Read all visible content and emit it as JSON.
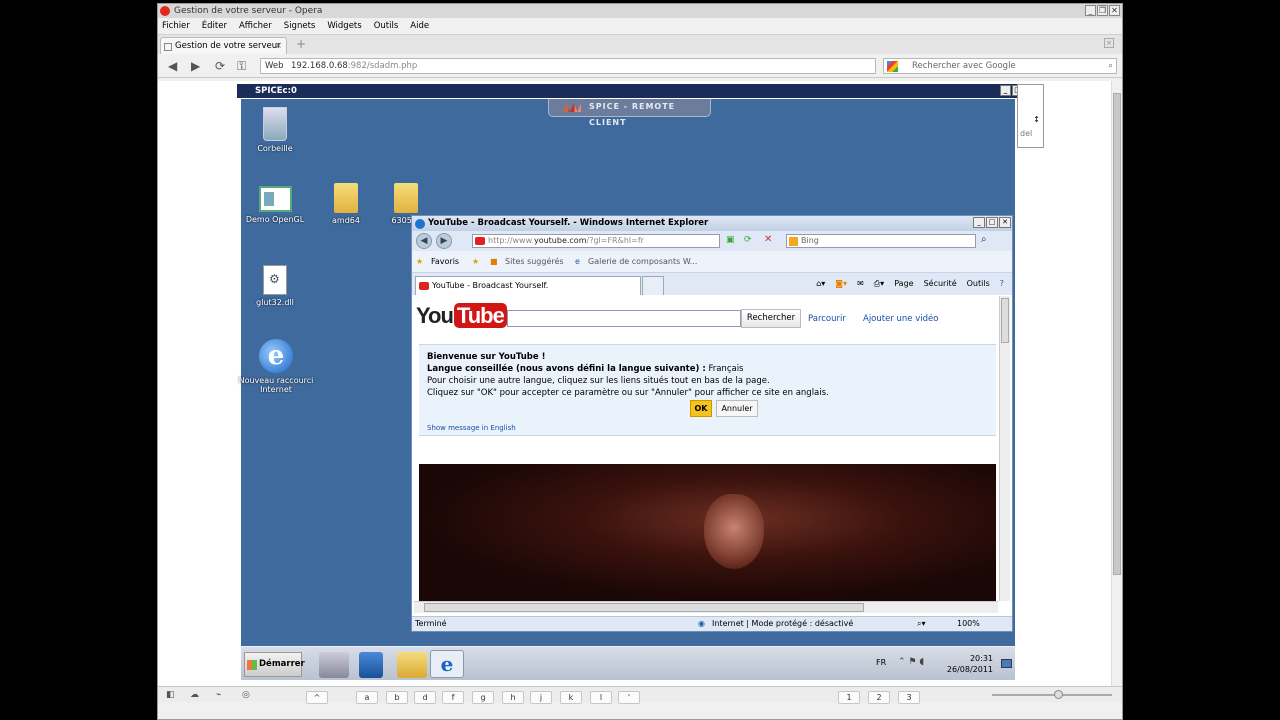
{
  "opera": {
    "title": "Gestion de votre serveur - Opera",
    "menu": [
      "Fichier",
      "Éditer",
      "Afficher",
      "Signets",
      "Widgets",
      "Outils",
      "Aide"
    ],
    "tab_label": "Gestion de votre serveur",
    "address_prefix": "Web",
    "url_main": "192.168.0.68",
    "url_rest": ":982/sdadm.php",
    "search_placeholder": "Rechercher avec Google"
  },
  "spice": {
    "window_title": "SPICEc:0",
    "banner": "SPICE - REMOTE CLIENT",
    "side_fragment": "del"
  },
  "desktop": {
    "icons": [
      {
        "label": "Corbeille",
        "icon": "recycle-bin-icon"
      },
      {
        "label": "Demo OpenGL",
        "icon": "opengl-app-icon"
      },
      {
        "label": "amd64",
        "icon": "folder-icon"
      },
      {
        "label": "6305_v",
        "icon": "folder-icon"
      },
      {
        "label": "glut32.dll",
        "icon": "dll-file-icon"
      },
      {
        "label": "Nouveau raccourci Internet",
        "icon": "internet-explorer-icon"
      }
    ]
  },
  "ie": {
    "title": "YouTube - Broadcast Yourself. - Windows Internet Explorer",
    "url_prefix": "http://www.",
    "url_main": "youtube.com",
    "url_rest": "/?gl=FR&hl=fr",
    "search_engine": "Bing",
    "favorites": {
      "favoris": "Favoris",
      "suggested": "Sites suggérés",
      "gallery": "Galerie de composants W..."
    },
    "tab_label": "YouTube - Broadcast Yourself.",
    "commands": [
      "Page",
      "Sécurité",
      "Outils"
    ],
    "status_done": "Terminé",
    "status_zone": "Internet | Mode protégé : désactivé",
    "zoom": "100%"
  },
  "youtube": {
    "logo_you": "You",
    "logo_tube": "Tube",
    "search_button": "Rechercher",
    "browse_link": "Parcourir",
    "upload_link": "Ajouter une vidéo",
    "welcome": "Bienvenue sur YouTube !",
    "lang_label": "Langue conseillée (nous avons défini la langue suivante) :",
    "lang_value": "Français",
    "line_choose": "Pour choisir une autre langue, cliquez sur les liens situés tout en bas de la page.",
    "line_ok": "Cliquez sur \"OK\" pour accepter ce paramètre ou sur \"Annuler\" pour afficher ce site en anglais.",
    "ok_button": "OK",
    "cancel_button": "Annuler",
    "show_english": "Show message in English"
  },
  "taskbar": {
    "start_label": "Démarrer",
    "lang": "FR",
    "time": "20:31",
    "date": "26/08/2011"
  },
  "keyboard": {
    "keys": [
      "^",
      "a",
      "b",
      "d",
      "f",
      "g",
      "h",
      "j",
      "k",
      "l",
      "'",
      "1",
      "2",
      "3"
    ]
  }
}
